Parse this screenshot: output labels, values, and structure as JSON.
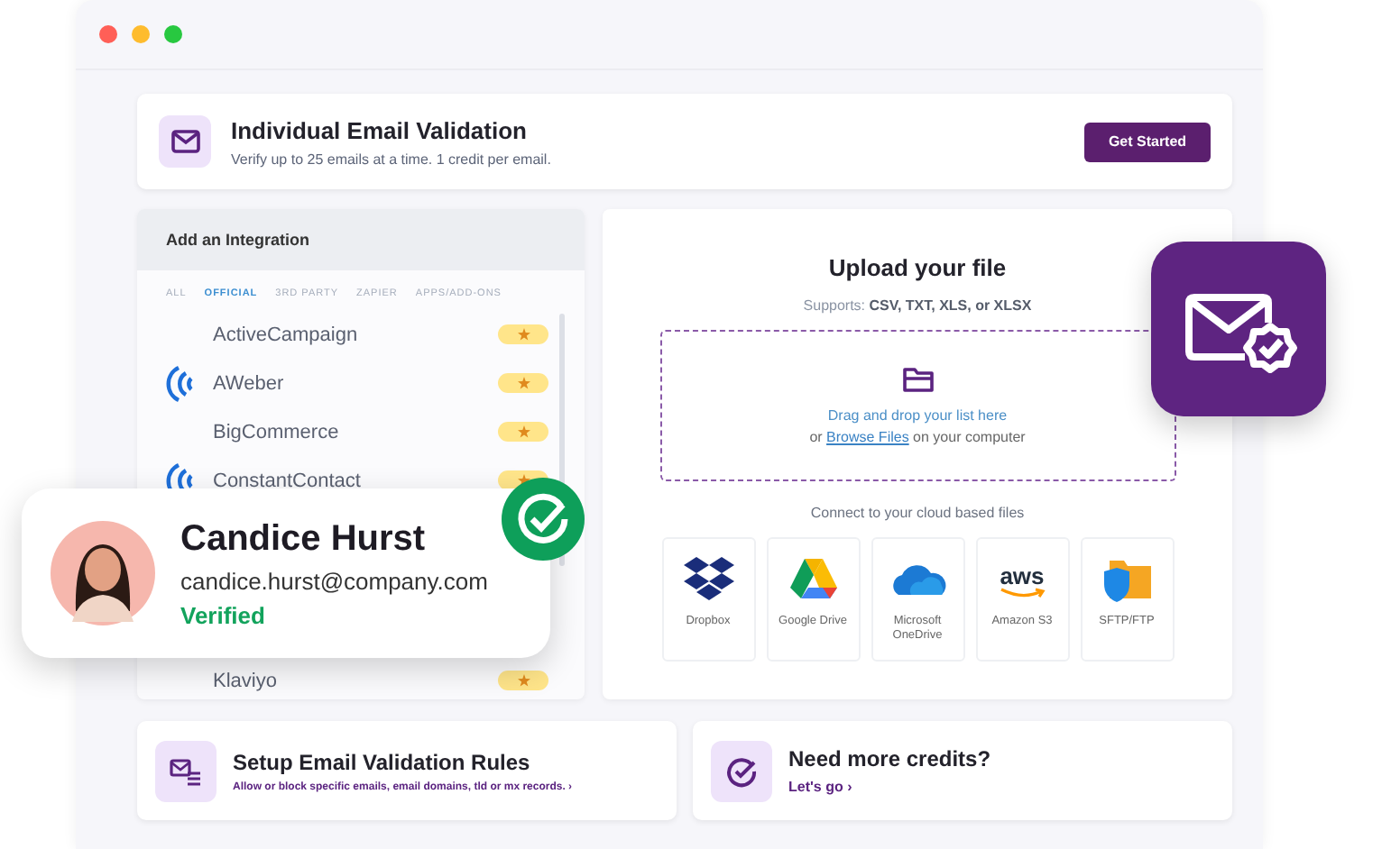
{
  "header": {
    "title": "Individual Email Validation",
    "subtitle": "Verify up to 25 emails at a time. 1 credit per email.",
    "button": "Get Started"
  },
  "integrations": {
    "title": "Add an Integration",
    "tabs": [
      {
        "label": "ALL",
        "selected": false
      },
      {
        "label": "OFFICIAL",
        "selected": true
      },
      {
        "label": "3RD PARTY",
        "selected": false
      },
      {
        "label": "ZAPIER",
        "selected": false
      },
      {
        "label": "APPS/ADD-ONS",
        "selected": false
      }
    ],
    "items": [
      {
        "name": "ActiveCampaign",
        "kind": "plain"
      },
      {
        "name": "AWeber",
        "kind": "logo"
      },
      {
        "name": "BigCommerce",
        "kind": "plain"
      },
      {
        "name": "ConstantContact",
        "kind": "logo"
      },
      {
        "name": "Klaviyo",
        "kind": "plain"
      }
    ]
  },
  "upload": {
    "title": "Upload your file",
    "supports": "Supports: **CSV, TXT, XLS, or XLSX**",
    "drop_text": "Drag and drop your list here",
    "browse_before": "or ",
    "browse_link": "Browse Files",
    "browse_after": " on your computer",
    "cloud_label": "Connect to your cloud based files",
    "services": [
      {
        "name": "Dropbox",
        "kind": "dropbox"
      },
      {
        "name": "Google Drive",
        "kind": "gdrive"
      },
      {
        "name": "Microsoft OneDrive",
        "kind": "onedrive"
      },
      {
        "name": "Amazon S3",
        "kind": "aws",
        "logo_text": "aws"
      },
      {
        "name": "SFTP/FTP",
        "kind": "sftp"
      }
    ]
  },
  "cards": [
    {
      "title": "Setup Email Validation Rules",
      "subtitle": "Allow or block specific emails, email domains, tld or mx records. ›",
      "kind": "rules"
    },
    {
      "title": "Need more credits?",
      "subtitle": "Let's go ›",
      "kind": "credits"
    }
  ],
  "profile": {
    "name": "Candice Hurst",
    "email": "candice.hurst@company.com",
    "status": "Verified",
    "verified": true
  }
}
